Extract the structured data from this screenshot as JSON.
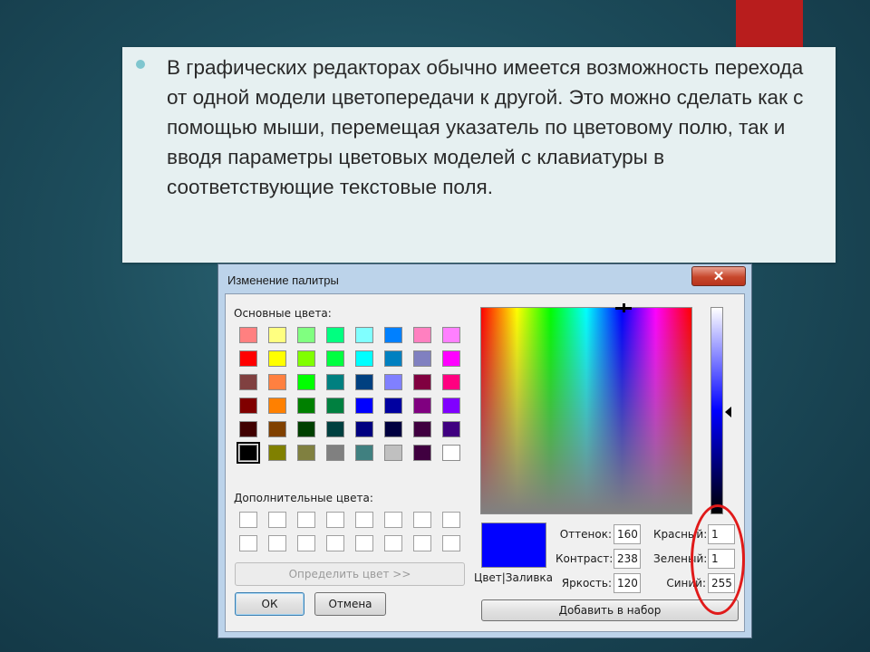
{
  "slide": {
    "bullet_text": "В графических редакторах обычно имеется возможность перехода от одной модели цветопередачи к другой. Это можно сделать как с помощью мыши, перемещая указатель по цветовому полю, так и вводя параметры цветовых моделей с клавиатуры в соответствующие текстовые поля."
  },
  "dialog": {
    "title": "Изменение палитры",
    "close_label": "✕",
    "basic_colors_label": "Основные цвета:",
    "custom_colors_label": "Дополнительные цвета:",
    "define_button": "Определить цвет >>",
    "ok_button": "ОК",
    "cancel_button": "Отмена",
    "add_button": "Добавить в набор",
    "preview_label": "Цвет|Заливка",
    "fields": {
      "hue_label": "Оттенок:",
      "hue_value": "160",
      "sat_label": "Контраст:",
      "sat_value": "238",
      "lum_label": "Яркость:",
      "lum_value": "120",
      "red_label": "Красный:",
      "red_value": "1",
      "green_label": "Зеленый:",
      "green_value": "1",
      "blue_label": "Синий:",
      "blue_value": "255"
    },
    "basic_colors": [
      [
        "#ff8080",
        "#ffff80",
        "#80ff80",
        "#00ff80",
        "#80ffff",
        "#0080ff",
        "#ff80c0",
        "#ff80ff"
      ],
      [
        "#ff0000",
        "#ffff00",
        "#80ff00",
        "#00ff40",
        "#00ffff",
        "#0080c0",
        "#8080c0",
        "#ff00ff"
      ],
      [
        "#804040",
        "#ff8040",
        "#00ff00",
        "#008080",
        "#004080",
        "#8080ff",
        "#800040",
        "#ff0080"
      ],
      [
        "#800000",
        "#ff8000",
        "#008000",
        "#008040",
        "#0000ff",
        "#0000a0",
        "#800080",
        "#8000ff"
      ],
      [
        "#400000",
        "#804000",
        "#004000",
        "#004040",
        "#000080",
        "#000040",
        "#400040",
        "#400080"
      ],
      [
        "#000000",
        "#808000",
        "#808040",
        "#808080",
        "#408080",
        "#c0c0c0",
        "#400040",
        "#ffffff"
      ]
    ],
    "selected_swatch": "#000000"
  },
  "colors": {
    "accent_red": "#b81d1d",
    "annotation_red": "#e01a1a",
    "current_color": "#0101ff"
  }
}
